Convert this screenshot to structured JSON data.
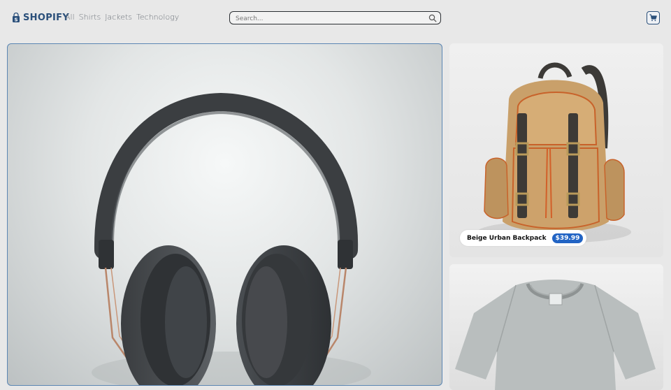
{
  "header": {
    "brand": "SHOPIFY",
    "nav": [
      "All",
      "Shirts",
      "Jackets",
      "Technology"
    ],
    "search_placeholder": "Search..."
  },
  "products": {
    "featured": {
      "image": "headphones",
      "icon": "headphones-image"
    },
    "side1": {
      "title": "Beige Urban Backpack",
      "price": "$39.99",
      "image": "backpack"
    },
    "side2": {
      "image": "t-shirt"
    }
  },
  "colors": {
    "brand": "#2a4f7a",
    "price_badge": "#2264c4",
    "background": "#e8e8e8"
  }
}
